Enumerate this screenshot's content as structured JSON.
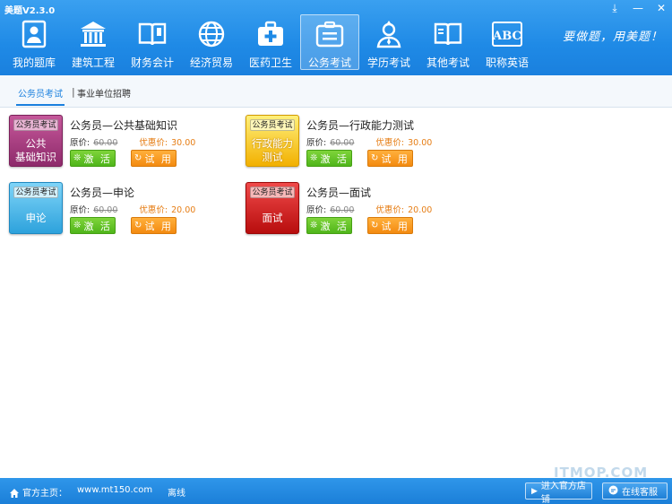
{
  "app": {
    "title": "美题V2.3.0",
    "slogan": "要做题，用美题！",
    "window_controls": {
      "download": "⤓",
      "minimize": "—",
      "close": "✕"
    }
  },
  "nav": {
    "items": [
      {
        "label": "我的题库",
        "icon": "user-card-icon"
      },
      {
        "label": "建筑工程",
        "icon": "building-icon"
      },
      {
        "label": "财务会计",
        "icon": "open-book-icon"
      },
      {
        "label": "经济贸易",
        "icon": "globe-icon"
      },
      {
        "label": "医药卫生",
        "icon": "medical-kit-icon"
      },
      {
        "label": "公务考试",
        "icon": "briefcase-icon",
        "active": true
      },
      {
        "label": "学历考试",
        "icon": "graduate-icon"
      },
      {
        "label": "其他考试",
        "icon": "open-book-icon"
      },
      {
        "label": "职称英语",
        "icon": "abc-icon"
      }
    ],
    "abc_text": "ABC"
  },
  "subtabs": {
    "active": "公务员考试",
    "separator": "|",
    "other": "事业单位招聘"
  },
  "labels": {
    "orig_price": "原价:",
    "discount_price": "优惠价:",
    "activate": "激 活",
    "trial": "试 用",
    "activate_icon": "❊",
    "trial_icon": "↻"
  },
  "products": [
    {
      "tag": "公务员考试",
      "subject": "公共\n基础知识",
      "name": "公务员—公共基础知识",
      "orig": "60.00",
      "disc": "30.00",
      "theme": "purple"
    },
    {
      "tag": "公务员考试",
      "subject": "行政能力\n测试",
      "name": "公务员—行政能力测试",
      "orig": "60.00",
      "disc": "30.00",
      "theme": "yellow"
    },
    {
      "tag": "公务员考试",
      "subject": "申论",
      "name": "公务员—申论",
      "orig": "60.00",
      "disc": "20.00",
      "theme": "blue"
    },
    {
      "tag": "公务员考试",
      "subject": "面试",
      "name": "公务员—面试",
      "orig": "60.00",
      "disc": "20.00",
      "theme": "red"
    }
  ],
  "status": {
    "home_label": "官方主页：",
    "home_url": "www.mt150.com",
    "connection": "离线",
    "store_button": "进入官方店铺",
    "service_button": "在线客服"
  },
  "watermark": "ITMOP.COM",
  "colors": {
    "primary": "#1a80de",
    "price_accent": "#e67e16",
    "activate_green": "#4fb51a",
    "trial_orange": "#f38a10"
  }
}
